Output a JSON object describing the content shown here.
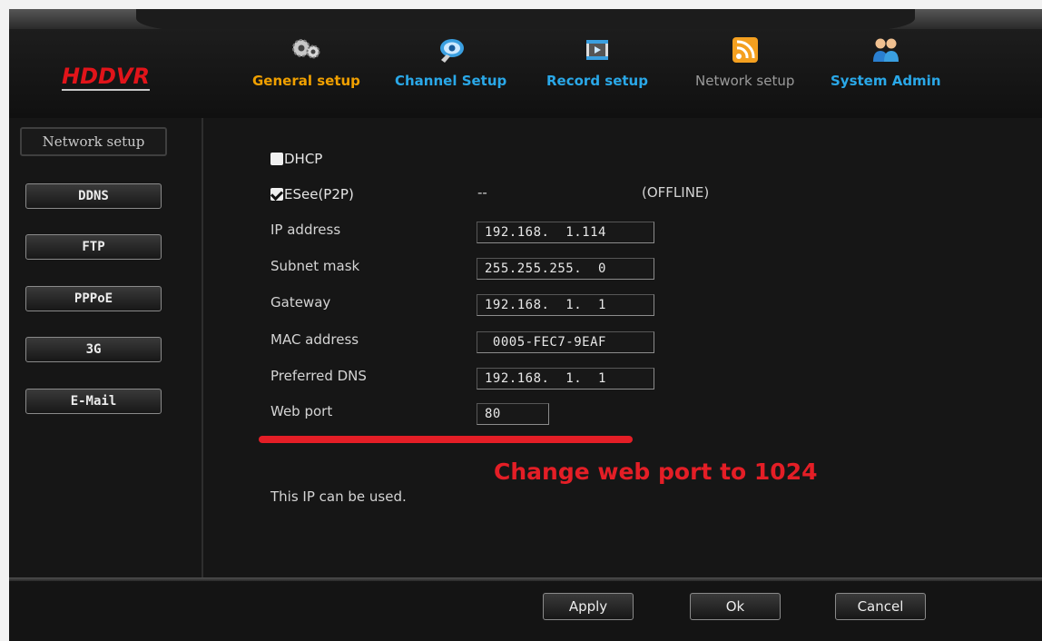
{
  "app": {
    "logo": "HDDVR"
  },
  "tabs": [
    {
      "label": "General setup",
      "icon": "gears-icon",
      "color": "#f0a000"
    },
    {
      "label": "Channel Setup",
      "icon": "camera-icon",
      "color": "#2aa8e8"
    },
    {
      "label": "Record setup",
      "icon": "film-icon",
      "color": "#2aa8e8"
    },
    {
      "label": "Network setup",
      "icon": "wifi-icon",
      "color": "#9a9a9a"
    },
    {
      "label": "System Admin",
      "icon": "users-icon",
      "color": "#2aa8e8"
    }
  ],
  "sidebar": {
    "items": [
      {
        "label": "Network setup",
        "active": true
      },
      {
        "label": "DDNS"
      },
      {
        "label": "FTP"
      },
      {
        "label": "PPPoE"
      },
      {
        "label": "3G"
      },
      {
        "label": "E-Mail"
      }
    ]
  },
  "form": {
    "dhcp": {
      "label": "DHCP",
      "checked": false
    },
    "esee": {
      "label": "ESee(P2P)",
      "checked": true,
      "id": "--",
      "status": "(OFFLINE)"
    },
    "ip_address": {
      "label": "IP address",
      "value": "192.168.  1.114"
    },
    "subnet_mask": {
      "label": "Subnet mask",
      "value": "255.255.255.  0"
    },
    "gateway": {
      "label": "Gateway",
      "value": "192.168.  1.  1"
    },
    "mac_address": {
      "label": "MAC address",
      "value": " 0005-FEC7-9EAF"
    },
    "preferred_dns": {
      "label": "Preferred DNS",
      "value": "192.168.  1.  1"
    },
    "web_port": {
      "label": "Web port",
      "value": "80"
    },
    "hint": "This IP can be used."
  },
  "annotation": {
    "text": "Change web port to 1024",
    "color": "#e41e26"
  },
  "buttons": {
    "apply": "Apply",
    "ok": "Ok",
    "cancel": "Cancel"
  }
}
